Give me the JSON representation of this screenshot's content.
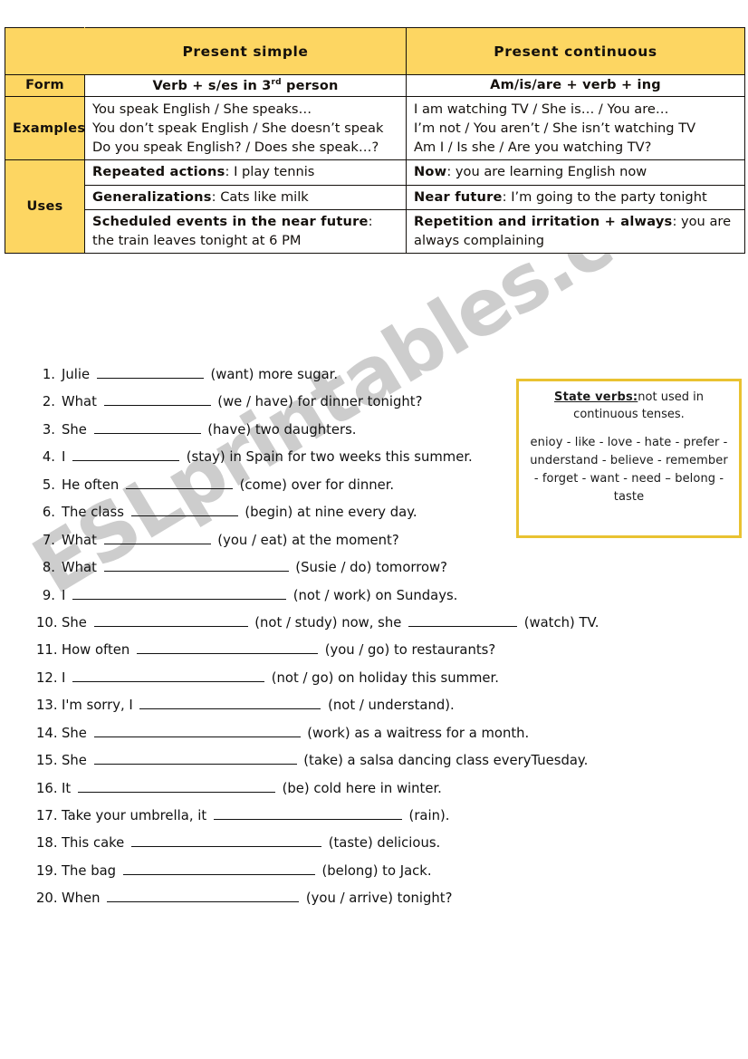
{
  "watermark": {
    "text": "ESLprintables.com"
  },
  "table": {
    "headers": {
      "blank": "",
      "present_simple": "Present simple",
      "present_continuous": "Present continuous"
    },
    "rows": [
      {
        "label": "Form",
        "simple_pre": "Verb + s/es in 3",
        "simple_sup": "rd",
        "simple_post": " person",
        "continuous": "Am/is/are + verb + ing"
      },
      {
        "label": "Examples",
        "simple_lines": [
          "You speak English / She speaks…",
          "You don’t speak English / She doesn’t speak",
          "Do you speak English? / Does she speak…?"
        ],
        "continuous_lines": [
          "I am watching TV / She is… / You are…",
          "I’m not / You aren’t / She isn’t watching TV",
          "Am I / Is she / Are you watching TV?"
        ]
      }
    ],
    "uses_label": "Uses",
    "uses": [
      {
        "simple_bold": "Repeated actions",
        "simple_rest": ": I play tennis",
        "cont_bold": "Now",
        "cont_rest": ": you are learning English now"
      },
      {
        "simple_bold": "Generalizations",
        "simple_rest": ": Cats like milk",
        "cont_bold": "Near future",
        "cont_rest": ": I’m going to the party tonight"
      },
      {
        "simple_bold": "Scheduled events in the near future",
        "simple_rest": ":",
        "simple_line2": "the train leaves tonight at 6 PM",
        "cont_bold": "Repetition and irritation + always",
        "cont_rest": ": you are",
        "cont_line2": "always complaining"
      }
    ]
  },
  "exercises": [
    {
      "num": "1.",
      "pre": "Julie ",
      "blank_w": 118,
      "post": " (want) more sugar."
    },
    {
      "num": "2.",
      "pre": "What ",
      "blank_w": 118,
      "post": " (we / have) for dinner tonight?"
    },
    {
      "num": "3.",
      "pre": "She ",
      "blank_w": 118,
      "post": " (have) two daughters."
    },
    {
      "num": "4.",
      "pre": "I ",
      "blank_w": 118,
      "post": " (stay) in Spain for two weeks this summer."
    },
    {
      "num": "5.",
      "pre": "He often ",
      "blank_w": 118,
      "post": " (come) over for dinner."
    },
    {
      "num": "6.",
      "pre": "The class ",
      "blank_w": 118,
      "post": " (begin) at nine every day."
    },
    {
      "num": "7.",
      "pre": "What ",
      "blank_w": 118,
      "post": " (you / eat) at the moment?"
    },
    {
      "num": "8.",
      "pre": "What ",
      "blank_w": 204,
      "post": " (Susie / do) tomorrow?"
    },
    {
      "num": "9.",
      "pre": "I ",
      "blank_w": 236,
      "post": " (not / work) on Sundays."
    },
    {
      "num": "10.",
      "pre": "She ",
      "blank_w": 170,
      "post": " (not / study) now, she ",
      "blank2_w": 120,
      "post2": " (watch) TV."
    },
    {
      "num": "11.",
      "pre": "How often ",
      "blank_w": 200,
      "post": " (you / go) to restaurants?"
    },
    {
      "num": "12.",
      "pre": "I ",
      "blank_w": 212,
      "post": " (not / go) on holiday this summer."
    },
    {
      "num": "13.",
      "pre": "I'm sorry, I ",
      "blank_w": 200,
      "post": " (not / understand)."
    },
    {
      "num": "14.",
      "pre": "She ",
      "blank_w": 228,
      "post": " (work) as a waitress for a month."
    },
    {
      "num": "15.",
      "pre": "She ",
      "blank_w": 224,
      "post": " (take) a salsa dancing class everyTuesday."
    },
    {
      "num": "16.",
      "pre": "It ",
      "blank_w": 218,
      "post": " (be) cold here in winter."
    },
    {
      "num": "17.",
      "pre": "Take your umbrella, it ",
      "blank_w": 208,
      "post": " (rain)."
    },
    {
      "num": "18.",
      "pre": "This cake ",
      "blank_w": 210,
      "post": " (taste) delicious."
    },
    {
      "num": "19.",
      "pre": "The bag ",
      "blank_w": 212,
      "post": " (belong) to Jack."
    },
    {
      "num": "20.",
      "pre": "When ",
      "blank_w": 212,
      "post": " (you / arrive) tonight?"
    }
  ],
  "state_verbs": {
    "title": "State verbs:",
    "head_rest": "not used in continuous tenses.",
    "list": "enioy - like - love - hate - prefer - understand - believe - remember - forget - want - need – belong - taste"
  },
  "colors": {
    "header_yellow": "#fdd662",
    "box_border": "#e9c231",
    "table_border": "#14100c",
    "watermark_gray": "#c9c9c9"
  }
}
